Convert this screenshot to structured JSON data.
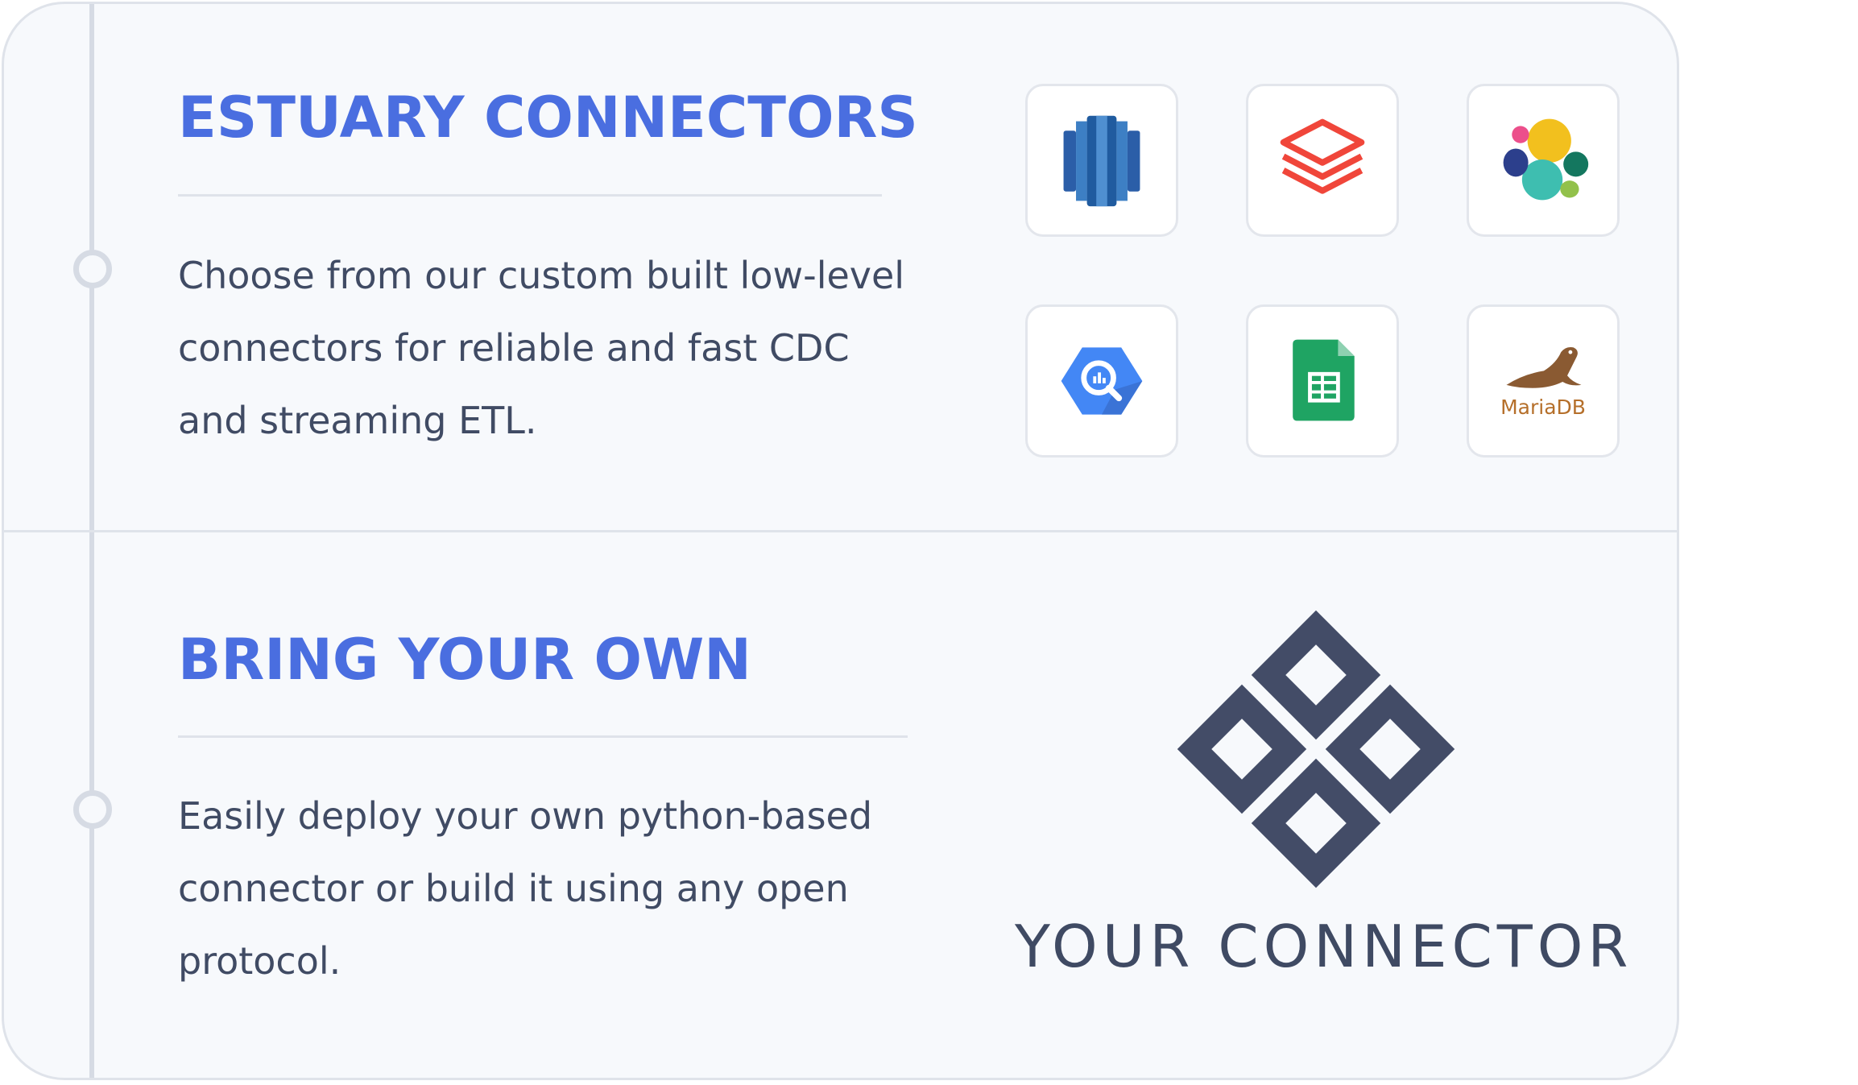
{
  "sections": [
    {
      "title": "ESTUARY CONNECTORS",
      "description": "Choose from our custom built low-level connectors for reliable and fast CDC and streaming ETL."
    },
    {
      "title": "BRING YOUR OWN",
      "description": "Easily deploy your own python-based connector or build it using any open protocol."
    }
  ],
  "connectors": [
    {
      "icon": "amazon-redshift-icon"
    },
    {
      "icon": "databricks-icon"
    },
    {
      "icon": "elasticsearch-icon"
    },
    {
      "icon": "google-bigquery-icon"
    },
    {
      "icon": "google-sheets-icon"
    },
    {
      "icon": "mariadb-icon",
      "label": "MariaDB"
    }
  ],
  "custom_connector": {
    "icon": "custom-connector-icon",
    "label": "YOUR CONNECTOR"
  },
  "colors": {
    "title": "#4a6ee0",
    "text": "#404b64",
    "logo": "#434c67",
    "card_background": "#f7f9fc",
    "border": "#dfe3ea"
  }
}
